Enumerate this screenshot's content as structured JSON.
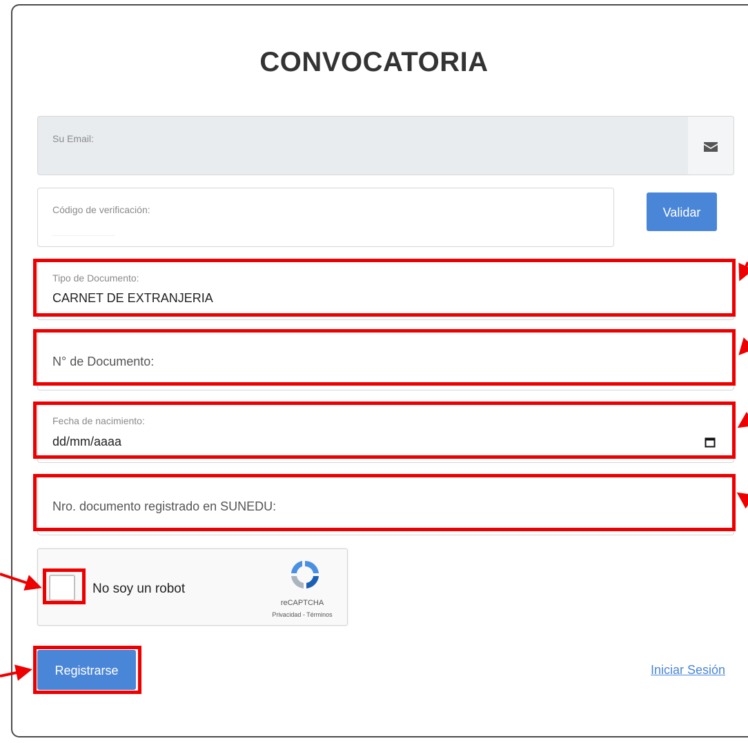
{
  "form": {
    "title": "CONVOCATORIA",
    "email_label": "Su Email:",
    "verification_label": "Código de verificación:",
    "validate_button": "Validar",
    "doc_type_label": "Tipo de Documento:",
    "doc_type_value": "CARNET DE EXTRANJERIA",
    "doc_number_placeholder": "N° de Documento:",
    "birth_label": "Fecha de nacimiento:",
    "birth_placeholder": "dd/mm/aaaa",
    "sunedu_placeholder": "Nro. documento registrado en SUNEDU:",
    "register_button": "Registrarse",
    "login_link": "Iniciar Sesión"
  },
  "recaptcha": {
    "label": "No soy un robot",
    "brand": "reCAPTCHA",
    "links": "Privacidad - Términos"
  },
  "icons": {
    "email": "envelope-icon",
    "birth": "calendar-icon",
    "captcha": "recaptcha-logo-icon"
  },
  "colors": {
    "primary": "#4a86d8",
    "highlight": "#ee0000",
    "disabled_bg": "#e9ecef"
  }
}
